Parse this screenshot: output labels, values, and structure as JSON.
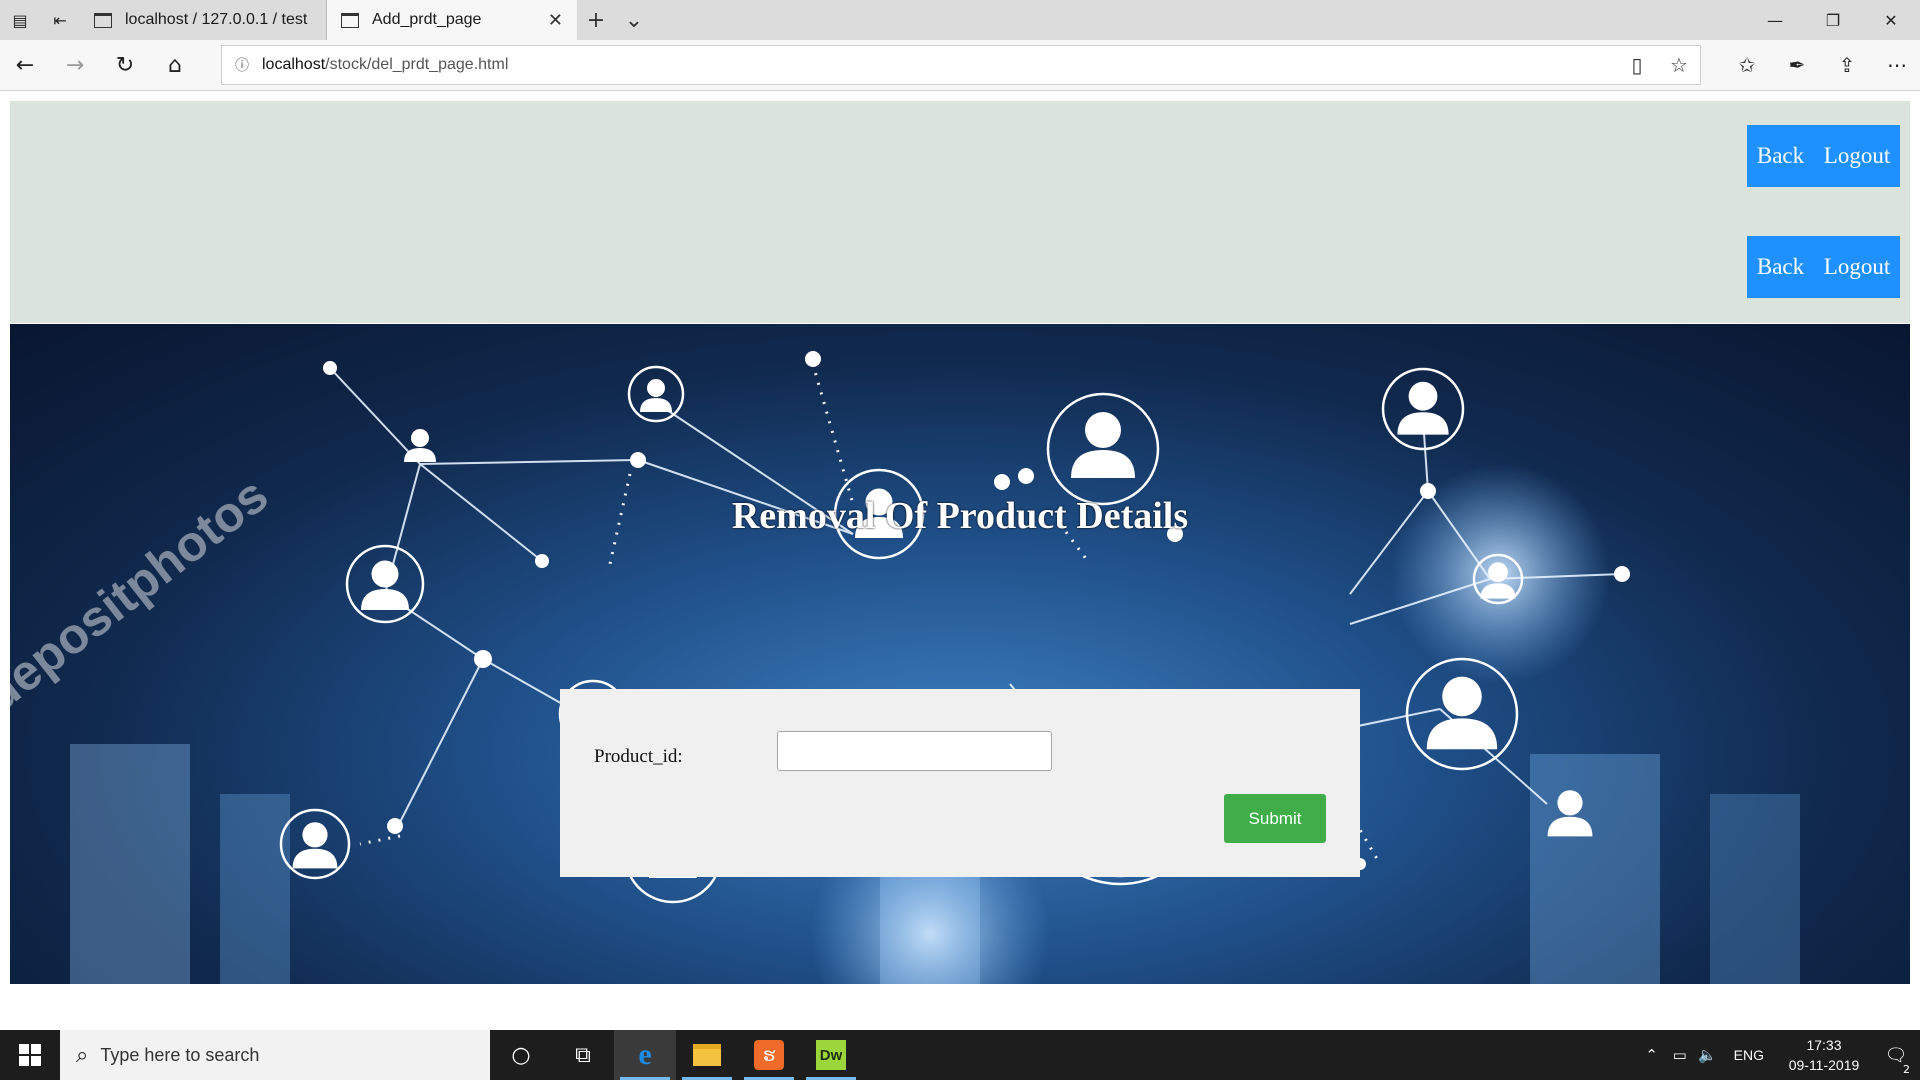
{
  "browser": {
    "tabs": [
      {
        "label": "localhost / 127.0.0.1 / test /",
        "active": false
      },
      {
        "label": "Add_prdt_page",
        "active": true
      }
    ],
    "address": {
      "host": "localhost",
      "path": "/stock/del_prdt_page.html"
    },
    "icons": {
      "tab_actions": "tab-actions-icon",
      "set_aside": "set-aside-tabs-icon",
      "back": "back-arrow-icon",
      "forward": "forward-arrow-icon",
      "refresh": "refresh-icon",
      "home": "home-icon",
      "reading_view": "reading-view-icon",
      "favorite": "star-icon",
      "favorites_list": "favorites-icon",
      "notes": "pen-icon",
      "share": "share-icon",
      "more": "more-icon"
    }
  },
  "header": {
    "rows": [
      {
        "back_label": "Back",
        "logout_label": "Logout"
      },
      {
        "back_label": "Back",
        "logout_label": "Logout"
      }
    ]
  },
  "hero": {
    "title": "Removal Of Product Details",
    "watermark_texts": [
      "depositphotos"
    ]
  },
  "form": {
    "field_label": "Product_id:",
    "field_value": "",
    "submit_label": "Submit"
  },
  "taskbar": {
    "search_placeholder": "Type here to search",
    "apps": [
      "cortana-icon",
      "task-view-icon",
      "edge-icon",
      "file-explorer-icon",
      "xampp-icon",
      "dreamweaver-icon"
    ],
    "xampp_glyph": "ຮ",
    "dw_label": "Dw",
    "language": "ENG",
    "time": "17:33",
    "date": "09-11-2019",
    "notification_count": "2"
  },
  "colors": {
    "header_bg": "#dae4dc",
    "link_button": "#1e90ff",
    "submit_button": "#3fae49",
    "form_bg": "#f0f0f0",
    "taskbar_bg": "#1d1d1d"
  }
}
